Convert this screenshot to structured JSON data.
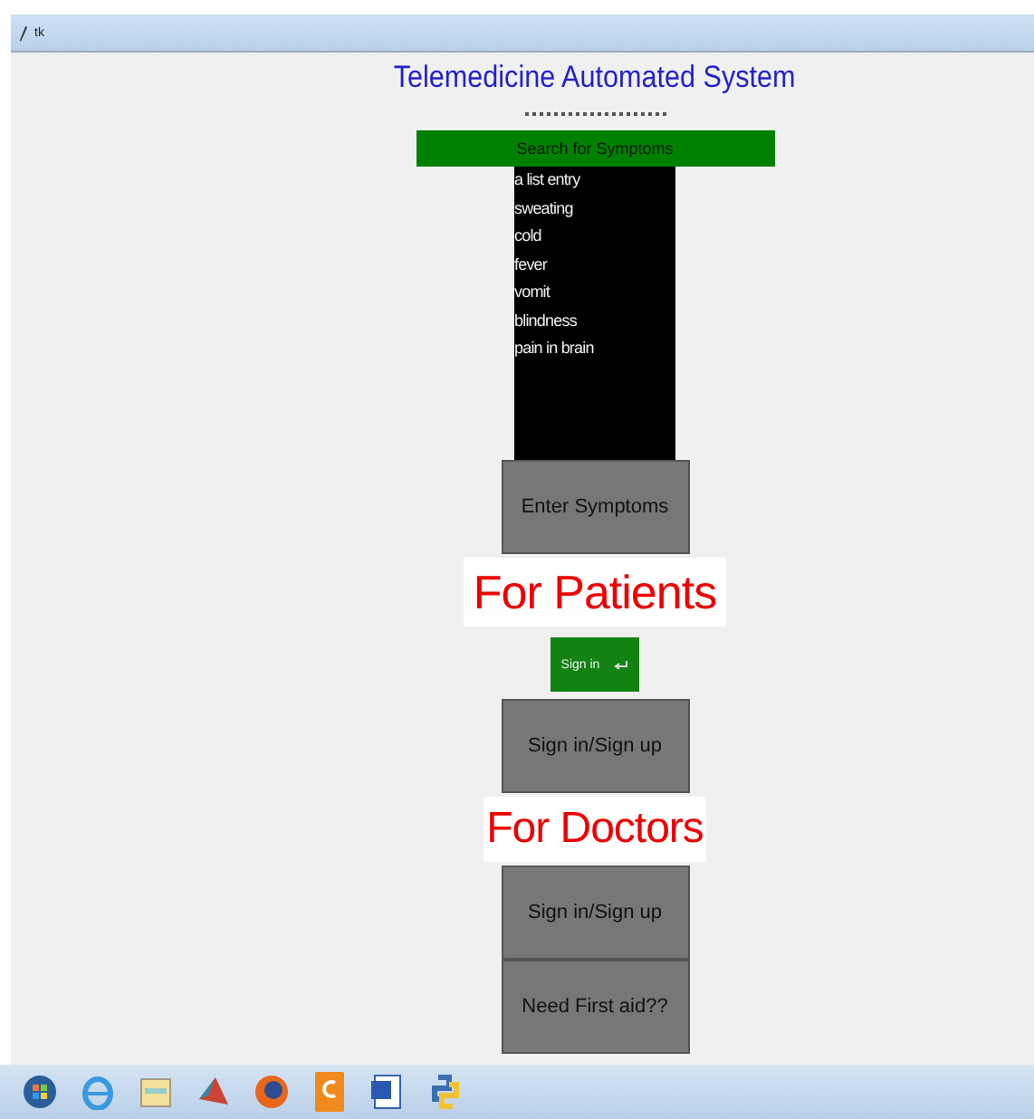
{
  "window": {
    "title": "tk"
  },
  "heading": "Telemedicine Automated System",
  "search": {
    "label": "Search for Symptoms"
  },
  "symptoms": [
    "a list entry",
    "sweating",
    "cold",
    "fever",
    "vomit",
    "blindness",
    "pain in brain"
  ],
  "enter_button": "Enter Symptoms",
  "patients": {
    "heading": "For Patients",
    "signin_button": "Sign in",
    "signup_button": "Sign in/Sign up"
  },
  "doctors": {
    "heading": "For Doctors",
    "signup_button": "Sign in/Sign up",
    "first_aid_button": "Need First aid??"
  },
  "taskbar": {
    "apps": [
      {
        "kind": "start"
      },
      {
        "kind": "browser"
      },
      {
        "kind": "folder"
      },
      {
        "kind": "cone"
      },
      {
        "kind": "fox"
      },
      {
        "kind": "orange"
      },
      {
        "kind": "word"
      },
      {
        "kind": "python"
      }
    ]
  }
}
